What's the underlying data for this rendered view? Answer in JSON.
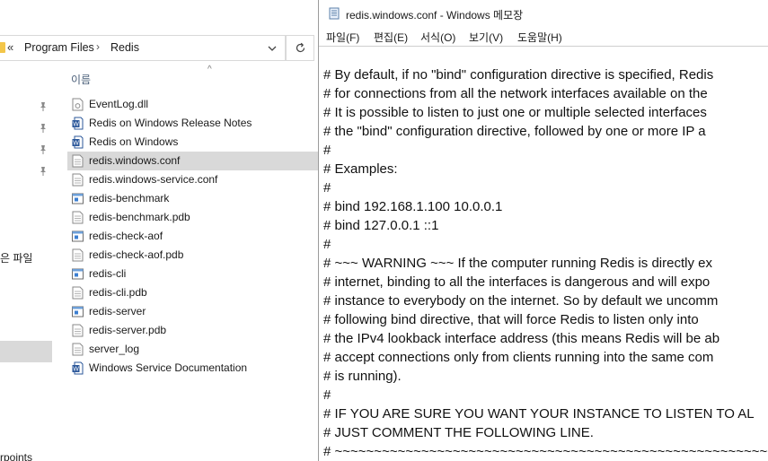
{
  "explorer": {
    "address": {
      "chevron": "«",
      "segments": [
        "Program Files",
        "Redis"
      ],
      "separator": "›"
    },
    "nav": {
      "recent_label": "은 파일",
      "bottom_label": "rpoints"
    },
    "column_header": "이름",
    "files": [
      {
        "name": "EventLog.dll",
        "icon": "dll-file-icon"
      },
      {
        "name": "Redis on Windows Release Notes",
        "icon": "word-doc-icon"
      },
      {
        "name": "Redis on Windows",
        "icon": "word-doc-icon"
      },
      {
        "name": "redis.windows.conf",
        "icon": "text-file-icon",
        "selected": true
      },
      {
        "name": "redis.windows-service.conf",
        "icon": "text-file-icon"
      },
      {
        "name": "redis-benchmark",
        "icon": "executable-icon"
      },
      {
        "name": "redis-benchmark.pdb",
        "icon": "text-file-icon"
      },
      {
        "name": "redis-check-aof",
        "icon": "executable-icon"
      },
      {
        "name": "redis-check-aof.pdb",
        "icon": "text-file-icon"
      },
      {
        "name": "redis-cli",
        "icon": "executable-icon"
      },
      {
        "name": "redis-cli.pdb",
        "icon": "text-file-icon"
      },
      {
        "name": "redis-server",
        "icon": "executable-icon"
      },
      {
        "name": "redis-server.pdb",
        "icon": "text-file-icon"
      },
      {
        "name": "server_log",
        "icon": "text-file-icon"
      },
      {
        "name": "Windows Service Documentation",
        "icon": "word-doc-icon"
      }
    ]
  },
  "notepad": {
    "title": "redis.windows.conf - Windows 메모장",
    "menu": [
      "파일(F)",
      "편집(E)",
      "서식(O)",
      "보기(V)",
      "도움말(H)"
    ],
    "lines": [
      "# By default, if no \"bind\" configuration directive is specified, Redis",
      "# for connections from all the network interfaces available on the",
      "# It is possible to listen to just one or multiple selected interfaces",
      "# the \"bind\" configuration directive, followed by one or more IP a",
      "#",
      "# Examples:",
      "#",
      "# bind 192.168.1.100 10.0.0.1",
      "# bind 127.0.0.1 ::1",
      "#",
      "# ~~~ WARNING ~~~ If the computer running Redis is directly ex",
      "# internet, binding to all the interfaces is dangerous and will expo",
      "# instance to everybody on the internet. So by default we uncomm",
      "# following bind directive, that will force Redis to listen only into",
      "# the IPv4 lookback interface address (this means Redis will be ab",
      "# accept connections only from clients running into the same com",
      "# is running).",
      "#",
      "# IF YOU ARE SURE YOU WANT YOUR INSTANCE TO LISTEN TO AL",
      "# JUST COMMENT THE FOLLOWING LINE.",
      "# ~~~~~~~~~~~~~~~~~~~~~~~~~~~~~~~~~~~~~~~~~~~~~~~~~~~~~~~~~~~~~"
    ]
  },
  "colors": {
    "selection": "#d9d9d9",
    "header_text": "#4c607a",
    "word_blue": "#2b579a",
    "exe_blue": "#3c7fd1"
  }
}
